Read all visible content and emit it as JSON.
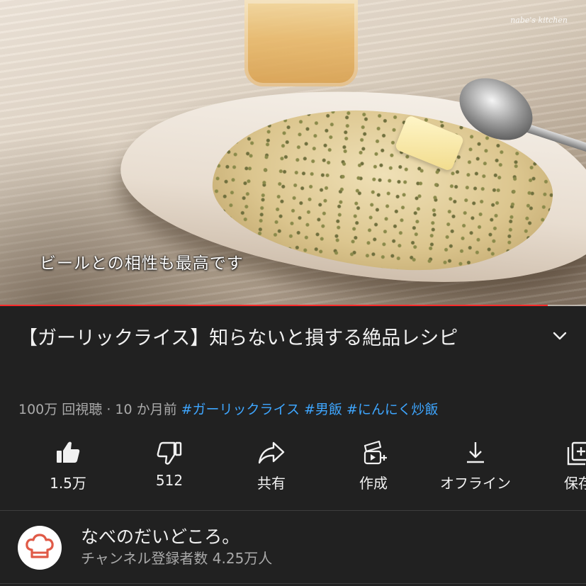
{
  "video": {
    "watermark": "nabe's kitchen",
    "subtitle": "ビールとの相性も最高です",
    "progress": 0.935
  },
  "title": {
    "text": "【ガーリックライス】知らないと損する絶品レシピ",
    "expand_icon": "chevron-down-icon"
  },
  "meta": {
    "views_and_date": "100万 回視聴 · 10 か月前",
    "hashtags": [
      "#ガーリックライス",
      "#男飯",
      "#にんにく炒飯"
    ]
  },
  "actions": [
    {
      "icon": "thumbs-up-icon",
      "label": "1.5万"
    },
    {
      "icon": "thumbs-down-icon",
      "label": "512"
    },
    {
      "icon": "share-icon",
      "label": "共有"
    },
    {
      "icon": "create-icon",
      "label": "作成"
    },
    {
      "icon": "download-icon",
      "label": "オフライン"
    },
    {
      "icon": "save-icon",
      "label": "保存"
    }
  ],
  "channel": {
    "name": "なべのだいどころ。",
    "subscribers": "チャンネル登録者数 4.25万人",
    "avatar_icon": "chef-hat-icon"
  },
  "colors": {
    "background": "#212121",
    "accent_red": "#ff2b2b",
    "hashtag_blue": "#3ea6ff",
    "avatar_icon": "#e05a47"
  }
}
